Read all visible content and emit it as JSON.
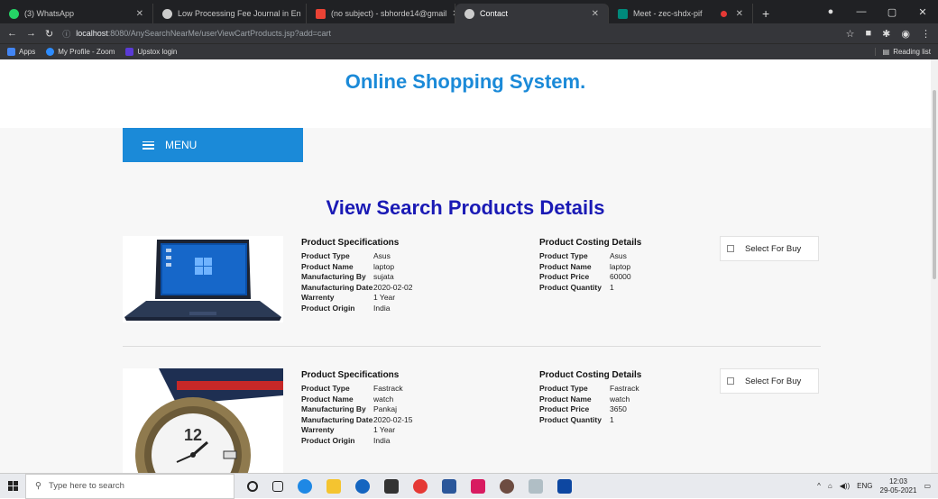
{
  "browser": {
    "tabs": [
      {
        "title": "(3) WhatsApp",
        "color": "#25d366",
        "active": false
      },
      {
        "title": "Low Processing Fee Journal in En",
        "color": "#cccccc",
        "active": false
      },
      {
        "title": "(no subject) - sbhorde14@gmail",
        "color": "#ea4335",
        "active": false
      },
      {
        "title": "Contact",
        "color": "#cccccc",
        "active": true
      },
      {
        "title": "Meet - zec-shdx-pif",
        "color": "#00897b",
        "active": false
      }
    ],
    "url_host": "localhost",
    "url_path": ":8080/AnySearchNearMe/userViewCartProducts.jsp?add=cart",
    "bookmarks": [
      "Apps",
      "My Profile - Zoom",
      "Upstox login"
    ],
    "reading_list": "Reading list"
  },
  "site": {
    "title": "Online Shopping System.",
    "menu_label": "MENU",
    "page_title": "View Search Products Details"
  },
  "products": [
    {
      "spec_heading": "Product Specifications",
      "specs": [
        {
          "k": "Product Type",
          "v": "Asus"
        },
        {
          "k": "Product Name",
          "v": "laptop"
        },
        {
          "k": "Manufacturing By",
          "v": "sujata"
        },
        {
          "k": "Manufacturing Date",
          "v": "2020-02-02"
        },
        {
          "k": "Warrenty",
          "v": "1 Year"
        },
        {
          "k": "Product Origin",
          "v": "India"
        }
      ],
      "cost_heading": "Product Costing Details",
      "costs": [
        {
          "k": "Product Type",
          "v": "Asus"
        },
        {
          "k": "Product Name",
          "v": "laptop"
        },
        {
          "k": "Product Price",
          "v": "60000"
        },
        {
          "k": "Product Quantity",
          "v": "1"
        }
      ],
      "buy_label": "Select For Buy"
    },
    {
      "spec_heading": "Product Specifications",
      "specs": [
        {
          "k": "Product Type",
          "v": "Fastrack"
        },
        {
          "k": "Product Name",
          "v": "watch"
        },
        {
          "k": "Manufacturing By",
          "v": "Pankaj"
        },
        {
          "k": "Manufacturing Date",
          "v": "2020-02-15"
        },
        {
          "k": "Warrenty",
          "v": "1 Year"
        },
        {
          "k": "Product Origin",
          "v": "India"
        }
      ],
      "cost_heading": "Product Costing Details",
      "costs": [
        {
          "k": "Product Type",
          "v": "Fastrack"
        },
        {
          "k": "Product Name",
          "v": "watch"
        },
        {
          "k": "Product Price",
          "v": "3650"
        },
        {
          "k": "Product Quantity",
          "v": "1"
        }
      ],
      "buy_label": "Select For Buy"
    }
  ],
  "taskbar": {
    "search_placeholder": "Type here to search",
    "lang": "ENG",
    "time": "12:03",
    "date": "29-05-2021"
  }
}
